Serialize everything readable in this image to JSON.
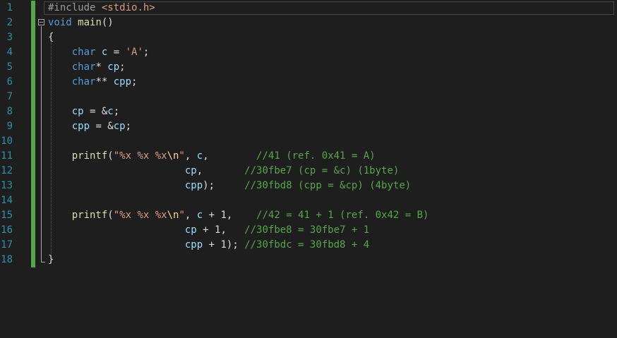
{
  "editor": {
    "lines": [
      {
        "num": "1",
        "tokens": [
          {
            "t": "#include",
            "c": "pre"
          },
          {
            "t": " "
          },
          {
            "t": "<stdio.h>",
            "c": "str"
          }
        ]
      },
      {
        "num": "2",
        "tokens": [
          {
            "t": "void",
            "c": "kw"
          },
          {
            "t": " "
          },
          {
            "t": "main",
            "c": "fn"
          },
          {
            "t": "()"
          }
        ]
      },
      {
        "num": "3",
        "tokens": [
          {
            "t": "{"
          }
        ]
      },
      {
        "num": "4",
        "tokens": [
          {
            "t": "    "
          },
          {
            "t": "char",
            "c": "kw"
          },
          {
            "t": " "
          },
          {
            "t": "c",
            "c": "var"
          },
          {
            "t": " = "
          },
          {
            "t": "'A'",
            "c": "str"
          },
          {
            "t": ";"
          }
        ]
      },
      {
        "num": "5",
        "tokens": [
          {
            "t": "    "
          },
          {
            "t": "char",
            "c": "kw"
          },
          {
            "t": "* "
          },
          {
            "t": "cp",
            "c": "var"
          },
          {
            "t": ";"
          }
        ]
      },
      {
        "num": "6",
        "tokens": [
          {
            "t": "    "
          },
          {
            "t": "char",
            "c": "kw"
          },
          {
            "t": "** "
          },
          {
            "t": "cpp",
            "c": "var"
          },
          {
            "t": ";"
          }
        ]
      },
      {
        "num": "7",
        "tokens": []
      },
      {
        "num": "8",
        "tokens": [
          {
            "t": "    "
          },
          {
            "t": "cp",
            "c": "var"
          },
          {
            "t": " = &"
          },
          {
            "t": "c",
            "c": "var"
          },
          {
            "t": ";"
          }
        ]
      },
      {
        "num": "9",
        "tokens": [
          {
            "t": "    "
          },
          {
            "t": "cpp",
            "c": "var"
          },
          {
            "t": " = &"
          },
          {
            "t": "cp",
            "c": "var"
          },
          {
            "t": ";"
          }
        ]
      },
      {
        "num": "10",
        "tokens": []
      },
      {
        "num": "11",
        "tokens": [
          {
            "t": "    "
          },
          {
            "t": "printf",
            "c": "fn"
          },
          {
            "t": "("
          },
          {
            "t": "\"%x %x %x",
            "c": "str"
          },
          {
            "t": "\\n",
            "c": "esc"
          },
          {
            "t": "\"",
            "c": "str"
          },
          {
            "t": ", "
          },
          {
            "t": "c",
            "c": "var"
          },
          {
            "t": ",        "
          },
          {
            "t": "//41 (ref. 0x41 = A)",
            "c": "com"
          }
        ]
      },
      {
        "num": "12",
        "tokens": [
          {
            "t": "                       "
          },
          {
            "t": "cp",
            "c": "var"
          },
          {
            "t": ",       "
          },
          {
            "t": "//30fbe7 (cp = &c) (1byte)",
            "c": "com"
          }
        ]
      },
      {
        "num": "13",
        "tokens": [
          {
            "t": "                       "
          },
          {
            "t": "cpp",
            "c": "var"
          },
          {
            "t": ");     "
          },
          {
            "t": "//30fbd8 (cpp = &cp) (4byte)",
            "c": "com"
          }
        ]
      },
      {
        "num": "14",
        "tokens": []
      },
      {
        "num": "15",
        "tokens": [
          {
            "t": "    "
          },
          {
            "t": "printf",
            "c": "fn"
          },
          {
            "t": "("
          },
          {
            "t": "\"%x %x %x",
            "c": "str"
          },
          {
            "t": "\\n",
            "c": "esc"
          },
          {
            "t": "\"",
            "c": "str"
          },
          {
            "t": ", "
          },
          {
            "t": "c",
            "c": "var"
          },
          {
            "t": " + 1,    "
          },
          {
            "t": "//42 = 41 + 1 (ref. 0x42 = B)",
            "c": "com"
          }
        ]
      },
      {
        "num": "16",
        "tokens": [
          {
            "t": "                       "
          },
          {
            "t": "cp",
            "c": "var"
          },
          {
            "t": " + 1,   "
          },
          {
            "t": "//30fbe8 = 30fbe7 + 1",
            "c": "com"
          }
        ]
      },
      {
        "num": "17",
        "tokens": [
          {
            "t": "                       "
          },
          {
            "t": "cpp",
            "c": "var"
          },
          {
            "t": " + 1); "
          },
          {
            "t": "//30fbdc = 30fbd8 + 4",
            "c": "com"
          }
        ]
      },
      {
        "num": "18",
        "tokens": [
          {
            "t": "}"
          }
        ]
      }
    ]
  }
}
